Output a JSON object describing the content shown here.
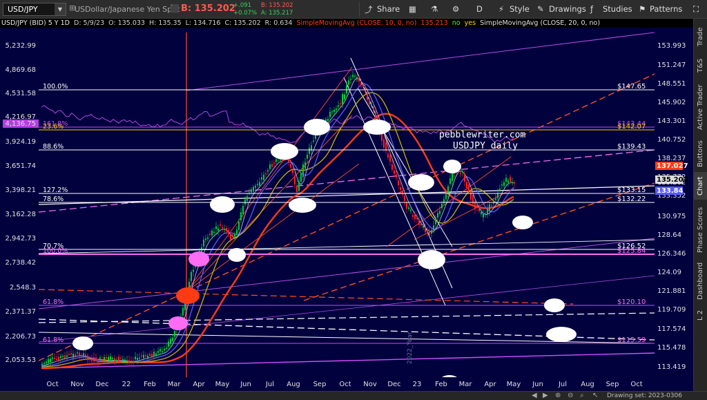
{
  "toolbar": {
    "symbol": "USD/JPY",
    "description": "USDollar/Japanese Yen Spot",
    "last_price": "B: 135.202",
    "change_abs": "+.091",
    "change_pct": "+0.07%",
    "bid": "B: 135.202",
    "ask": "A: 135.217",
    "share_label": "Share",
    "period_label": "D",
    "style_label": "Style",
    "drawings_label": "Drawings",
    "studies_label": "Studies",
    "patterns_label": "Patterns"
  },
  "study_bar": {
    "header": "USD/JPY (BID) 5 Y 1D",
    "date": "D: 5/9/23",
    "open": "O: 135.033",
    "high": "H: 135.35",
    "low": "L: 134.716",
    "close": "C: 135.202",
    "range": "R: 0.634",
    "sma10": "SimpleMovingAvg (CLOSE, 10, 0, no)",
    "sma10_val": "135.213",
    "no1": "no",
    "yes1": "yes",
    "sma20": "SimpleMovingAvg (CLOSE, 20, 0, no)"
  },
  "colors": {
    "chart_bg": "#01013e",
    "fib_white": "#ffffff",
    "ma_red": "#ff3c14",
    "ma_blue": "#5a5aff",
    "ma_yellow": "#c8b400",
    "overlay_purple": "#c850f0",
    "trend_orange": "#ff5020",
    "bubble_pink": "#ff6cf4",
    "bubble_red": "#ff3b14",
    "bubble_yellow": "#ffe000",
    "candle_up": "#00d030",
    "candle_down": "#ff2020"
  },
  "left_axis": [
    "5,232.99",
    "4,869.68",
    "4,531.58",
    "4,216.97",
    "4,136.75",
    "3,924.19",
    "3,651.74",
    "3,398.21",
    "3,162.28",
    "2,942.73",
    "2,738.42",
    "2,548.3",
    "2,371.37",
    "2,206.73",
    "2,053.53"
  ],
  "right_axis": [
    "153.993",
    "151.247",
    "148.551",
    "145.902",
    "143.301",
    "140.752",
    "138.237",
    "135.772",
    "135.202",
    "133.84",
    "133.352",
    "130.975",
    "128.64",
    "126.346",
    "124.09",
    "121.881",
    "119.709",
    "117.574",
    "115.478",
    "113.419"
  ],
  "right_flags": [
    "137.027",
    "135.202",
    "133.84"
  ],
  "x_labels": [
    "Oct",
    "Nov",
    "Dec",
    "22",
    "Feb",
    "Mar",
    "Apr",
    "May",
    "Jun",
    "Jul",
    "Aug",
    "Sep",
    "Oct",
    "Nov",
    "Dec",
    "23",
    "Feb",
    "Mar",
    "Apr",
    "May",
    "Jun",
    "Jul",
    "Aug",
    "Sep",
    "Oct"
  ],
  "fib_levels": [
    {
      "pct": "100.0%",
      "price": "$147.65"
    },
    {
      "pct": "161.8%",
      "price": "$143.44"
    },
    {
      "pct": "23.6%",
      "price": "$142.07"
    },
    {
      "pct": "88.6%",
      "price": "$139.43"
    },
    {
      "pct": "127.2%",
      "price": "$133.15"
    },
    {
      "pct": "78.6%",
      "price": "$132.22"
    },
    {
      "pct": "70.7%",
      "price": "$126.52"
    },
    {
      "pct": "100.0%",
      "price": "$125.84"
    },
    {
      "pct": "61.8%",
      "price": "$120.10"
    },
    {
      "pct": "61.8%",
      "price": "$115.59"
    }
  ],
  "watermark": {
    "line1": "pebblewriter.com",
    "line2": "USDJPY daily"
  },
  "year_marker": "2022_Year",
  "side_tabs": [
    "Trade",
    "T&S",
    "Active Trader",
    "Buttons",
    "Chart",
    "Phase Scores",
    "Dashboard",
    "L 2"
  ],
  "bottom": {
    "drawing_set": "Drawing set: 2023-0306"
  }
}
